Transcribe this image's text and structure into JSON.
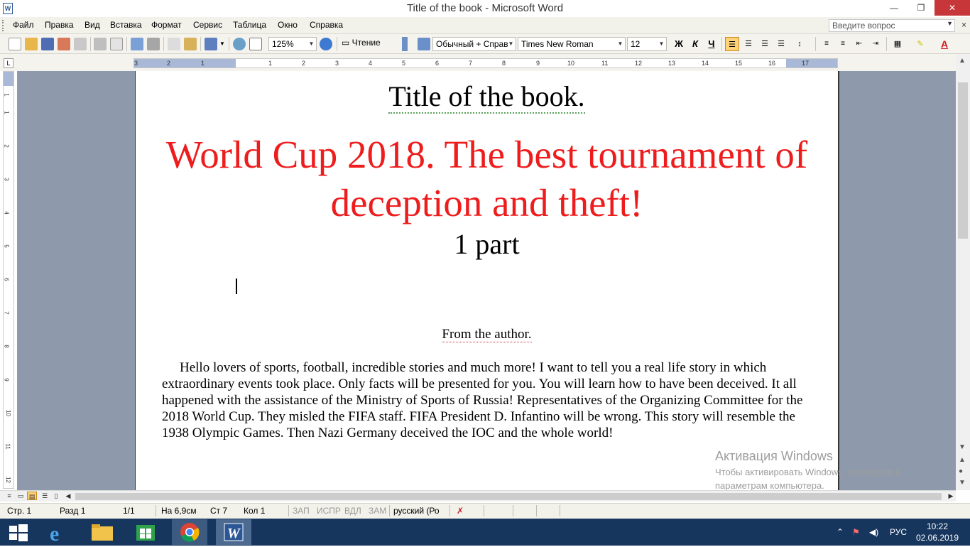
{
  "window": {
    "title": "Title of the book - Microsoft Word",
    "min_label": "—",
    "max_label": "❐",
    "close_label": "✕"
  },
  "menu": {
    "items": [
      "Файл",
      "Правка",
      "Вид",
      "Вставка",
      "Формат",
      "Сервис",
      "Таблица",
      "Окно",
      "Справка"
    ],
    "ask_placeholder": "Введите вопрос",
    "close_label": "×"
  },
  "toolbar": {
    "zoom": "125%",
    "reading_label": "Чтение",
    "style": "Обычный + Справ",
    "font": "Times New Roman",
    "size": "12",
    "bold_label": "Ж",
    "italic_label": "К",
    "underline_label": "Ч"
  },
  "ruler": {
    "ticks": [
      "3",
      "2",
      "1",
      "1",
      "2",
      "3",
      "4",
      "5",
      "6",
      "7",
      "8",
      "9",
      "10",
      "11",
      "12",
      "13",
      "14",
      "15",
      "16",
      "17"
    ],
    "vticks": [
      "1",
      "1",
      "2",
      "3",
      "4",
      "5",
      "6",
      "7",
      "8",
      "9",
      "10",
      "11",
      "12"
    ]
  },
  "document": {
    "title": "Title of the book.",
    "headline": "World Cup 2018. The best tournament of deception and theft!",
    "part": "1 part",
    "from_author": "From the author.",
    "body": "Hello lovers of sports, football, incredible stories and much more! I want to tell you a real life story in which extraordinary events took place. Only facts will be presented for you. You will learn how to have been deceived. It all happened with the assistance of the Ministry of Sports of Russia! Representatives of the Organizing Committee for the 2018 World Cup. They misled the FIFA staff. FIFA President D. Infantino will be wrong. This story will resemble the 1938 Olympic Games. Then Nazi Germany deceived the IOC and the whole world!"
  },
  "watermark": {
    "line1": "Активация Windows",
    "line2": "Чтобы активировать Windows, перейдите к параметрам компьютера."
  },
  "status": {
    "page": "Стр. 1",
    "section": "Разд 1",
    "pages": "1/1",
    "at": "На 6,9см",
    "line": "Ст 7",
    "col": "Кол 1",
    "rec": "ЗАП",
    "trk": "ИСПР",
    "ext": "ВДЛ",
    "ovr": "ЗАМ",
    "lang": "русский (Ро"
  },
  "taskbar": {
    "lang": "РУС",
    "time": "10:22",
    "date": "02.06.2019"
  },
  "colors": {
    "headline": "#ee1c1c",
    "taskbar": "#17365e",
    "close": "#c7373a"
  }
}
